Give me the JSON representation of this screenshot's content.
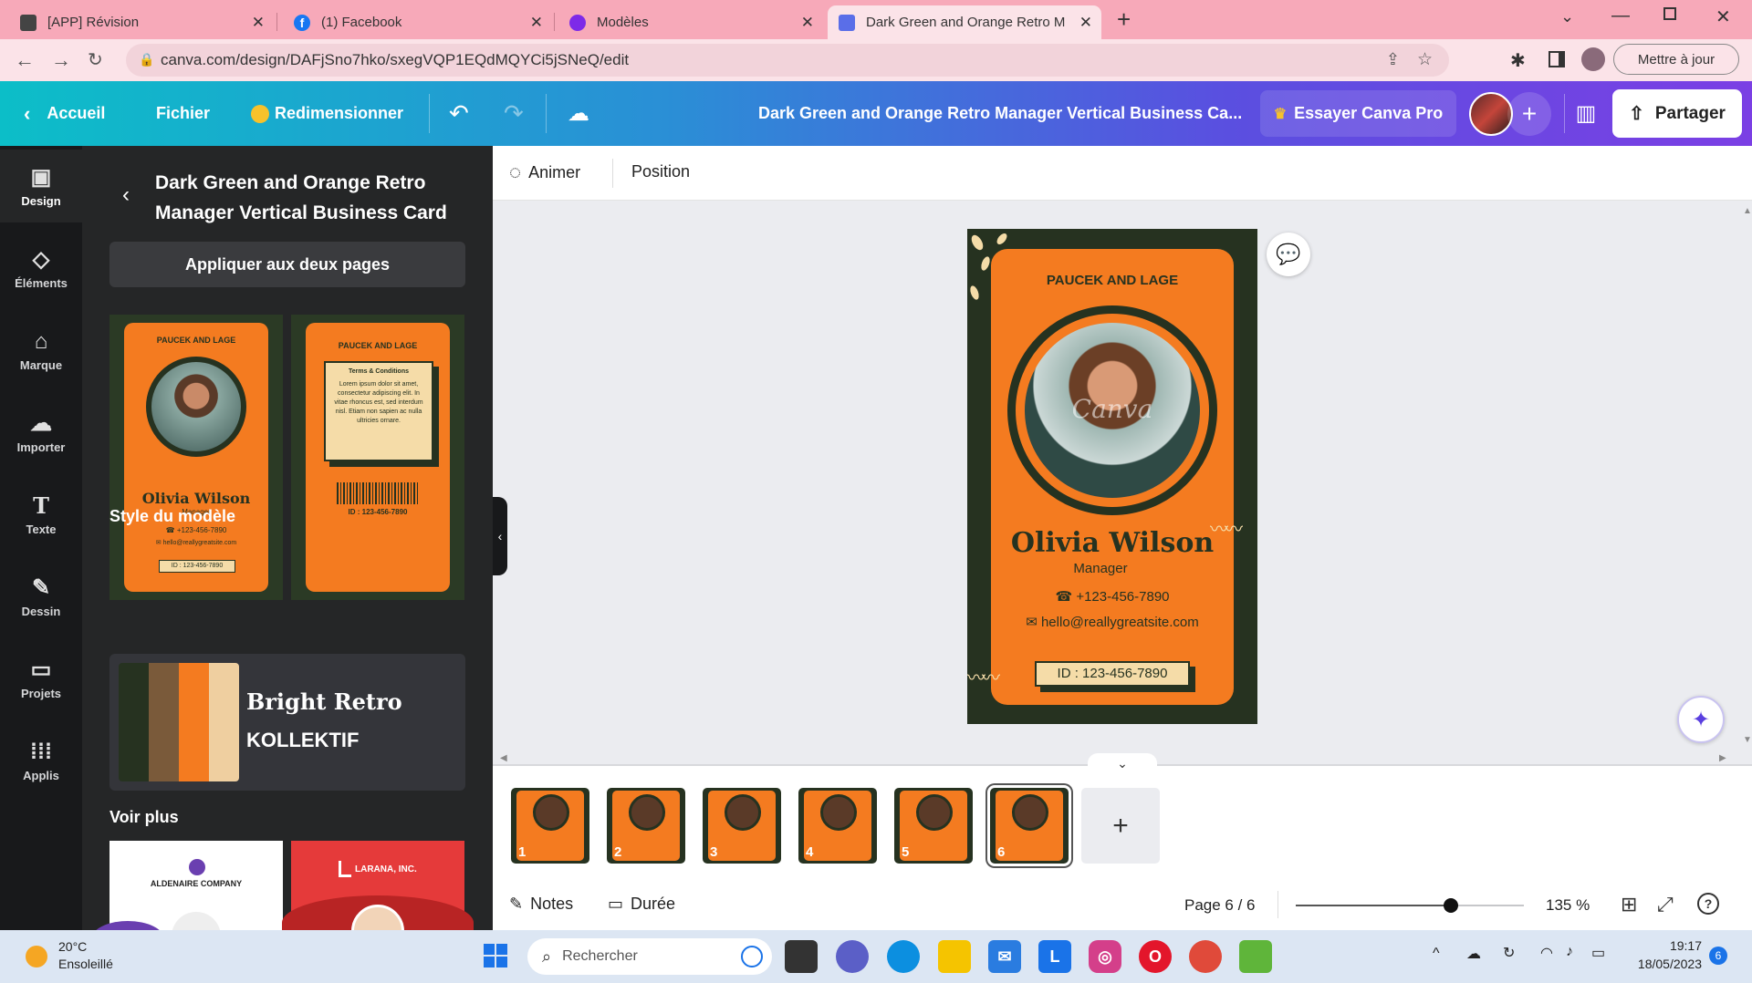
{
  "browser": {
    "tabs": [
      {
        "label": "[APP] Révision",
        "icon": "notion-icon"
      },
      {
        "label": "(1) Facebook",
        "icon": "facebook-icon"
      },
      {
        "label": "Modèles",
        "icon": "canva-icon"
      },
      {
        "label": "Dark Green and Orange Retro M",
        "icon": "canva-doc-icon"
      }
    ],
    "url": "canva.com/design/DAFjSno7hko/sxegVQP1EQdMQYCi5jSNeQ/edit",
    "update_label": "Mettre à jour"
  },
  "header": {
    "home_label": "Accueil",
    "file_label": "Fichier",
    "resize_label": "Redimensionner",
    "doc_title": "Dark Green and Orange Retro Manager Vertical Business Ca...",
    "try_pro_label": "Essayer Canva Pro",
    "share_label": "Partager"
  },
  "rail": [
    {
      "label": "Design",
      "icon": "design-icon"
    },
    {
      "label": "Éléments",
      "icon": "elements-icon"
    },
    {
      "label": "Marque",
      "icon": "brand-icon"
    },
    {
      "label": "Importer",
      "icon": "upload-icon"
    },
    {
      "label": "Texte",
      "icon": "text-icon"
    },
    {
      "label": "Dessin",
      "icon": "draw-icon"
    },
    {
      "label": "Projets",
      "icon": "folder-icon"
    },
    {
      "label": "Applis",
      "icon": "apps-icon"
    }
  ],
  "panel": {
    "title": "Dark Green and Orange Retro Manager Vertical Business Card",
    "apply_label": "Appliquer aux deux pages",
    "style_section": "Style du modèle",
    "style_font_1": "Bright Retro",
    "style_font_2": "KOLLEKTIF",
    "see_more": "Voir plus",
    "palette": [
      "#263220",
      "#7a5a3a",
      "#f47b20",
      "#efcfa0"
    ],
    "templates": [
      {
        "company": "ALDENAIRE COMPANY"
      },
      {
        "company": "LARANA, INC."
      }
    ]
  },
  "card_front": {
    "company": "PAUCEK AND LAGE",
    "name": "Olivia Wilson",
    "role": "Manager",
    "phone": "+123-456-7890",
    "email": "hello@reallygreatsite.com",
    "id": "ID : 123-456-7890",
    "watermark": "Canva"
  },
  "card_back": {
    "company": "PAUCEK AND LAGE",
    "terms_title": "Terms & Conditions",
    "terms_body": "Lorem ipsum dolor sit amet, consectetur adipiscing elit. In vitae rhoncus est, sed interdum nisl. Etiam non sapien ac nulla ultricies ornare.",
    "id": "ID : 123-456-7890"
  },
  "toolbar": {
    "animate_label": "Animer",
    "position_label": "Position"
  },
  "pages": [
    "1",
    "2",
    "3",
    "4",
    "5",
    "6"
  ],
  "footer": {
    "notes_label": "Notes",
    "duration_label": "Durée",
    "page_indicator": "Page 6 / 6",
    "zoom": "135 %",
    "zoom_fraction": 0.68
  },
  "taskbar": {
    "weather_temp": "20°C",
    "weather_desc": "Ensoleillé",
    "search_placeholder": "Rechercher",
    "time": "19:17",
    "date": "18/05/2023",
    "notif_count": "6"
  },
  "colors": {
    "orange": "#f47b20",
    "dark_green": "#263220",
    "cream": "#f5dca8"
  }
}
